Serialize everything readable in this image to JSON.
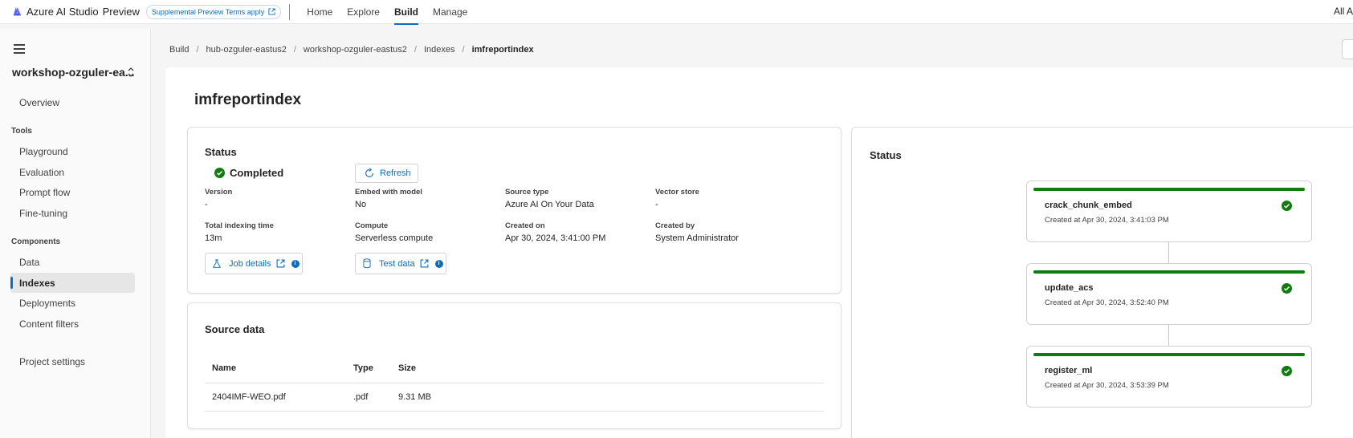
{
  "topbar": {
    "brand": "Azure AI Studio",
    "preview": "Preview",
    "preview_terms": "Supplemental Preview Terms apply",
    "nav": [
      "Home",
      "Explore",
      "Build",
      "Manage"
    ],
    "active_nav": "Build",
    "right_text": "All A"
  },
  "sidebar": {
    "project_name": "workshop-ozguler-ea...",
    "overview": "Overview",
    "tools_header": "Tools",
    "tools": [
      "Playground",
      "Evaluation",
      "Prompt flow",
      "Fine-tuning"
    ],
    "components_header": "Components",
    "components": [
      "Data",
      "Indexes",
      "Deployments",
      "Content filters"
    ],
    "active_item": "Indexes",
    "project_settings": "Project settings"
  },
  "breadcrumb": [
    "Build",
    "hub-ozguler-eastus2",
    "workshop-ozguler-eastus2",
    "Indexes",
    "imfreportindex"
  ],
  "page": {
    "title": "imfreportindex"
  },
  "status_card": {
    "title": "Status",
    "status": "Completed",
    "refresh_label": "Refresh",
    "fields": {
      "version_label": "Version",
      "version_value": "-",
      "embed_label": "Embed with model",
      "embed_value": "No",
      "source_type_label": "Source type",
      "source_type_value": "Azure AI On Your Data",
      "vector_store_label": "Vector store",
      "vector_store_value": "-",
      "total_time_label": "Total indexing time",
      "total_time_value": "13m",
      "compute_label": "Compute",
      "compute_value": "Serverless compute",
      "created_on_label": "Created on",
      "created_on_value": "Apr 30, 2024, 3:41:00 PM",
      "created_by_label": "Created by",
      "created_by_value": "System Administrator"
    },
    "job_details_label": "Job details",
    "test_data_label": "Test data"
  },
  "source_data": {
    "title": "Source data",
    "columns": [
      "Name",
      "Type",
      "Size"
    ],
    "rows": [
      {
        "name": "2404IMF-WEO.pdf",
        "type": ".pdf",
        "size": "9.31 MB"
      }
    ]
  },
  "pipeline": {
    "title": "Status",
    "status_color": "#107c10",
    "steps": [
      {
        "name": "crack_chunk_embed",
        "time": "Created at Apr 30, 2024, 3:41:03 PM"
      },
      {
        "name": "update_acs",
        "time": "Created at Apr 30, 2024, 3:52:40 PM"
      },
      {
        "name": "register_ml",
        "time": "Created at Apr 30, 2024, 3:53:39 PM"
      }
    ]
  },
  "colors": {
    "accent": "#0f6cbd",
    "success": "#107c10"
  }
}
